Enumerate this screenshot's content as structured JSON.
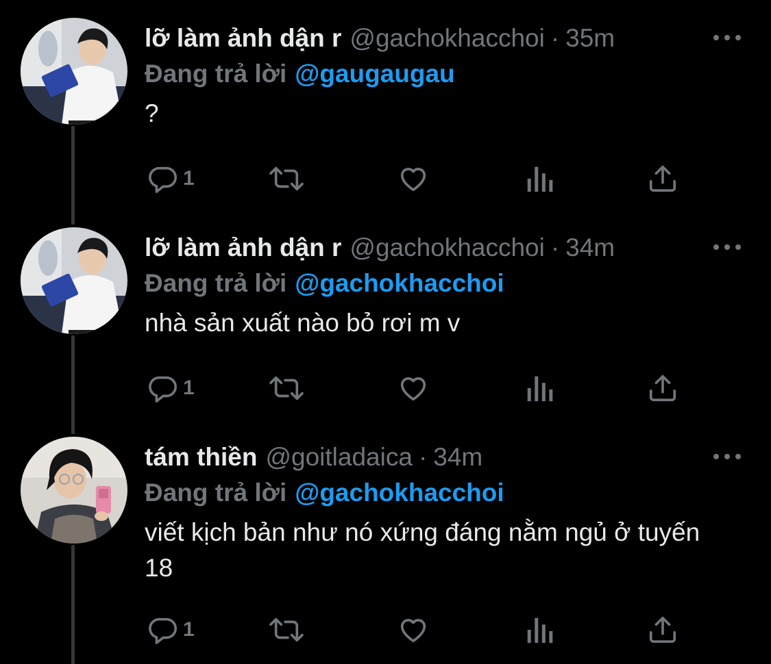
{
  "tweets": [
    {
      "display_name": "lỡ làm ảnh dận r",
      "handle": "@gachokhacchoi",
      "separator": "·",
      "time": "35m",
      "reply_label": "Đang trả lời",
      "reply_to": "@gaugaugau",
      "text": "?",
      "reply_count": "1",
      "avatar": "avatar-reading-airplane"
    },
    {
      "display_name": "lỡ làm ảnh dận r",
      "handle": "@gachokhacchoi",
      "separator": "·",
      "time": "34m",
      "reply_label": "Đang trả lời",
      "reply_to": "@gachokhacchoi",
      "text": "nhà sản xuất nào bỏ rơi m v",
      "reply_count": "1",
      "avatar": "avatar-reading-airplane"
    },
    {
      "display_name": "tám thiền",
      "handle": "@goitladaica",
      "separator": "·",
      "time": "34m",
      "reply_label": "Đang trả lời",
      "reply_to": "@gachokhacchoi",
      "text": "viết kịch bản như nó xứng đáng nằm ngủ ở tuyến 18",
      "reply_count": "1",
      "avatar": "avatar-mirror-selfie"
    }
  ],
  "icons": {
    "reply": "reply-icon",
    "retweet": "retweet-icon",
    "like": "like-icon",
    "views": "views-icon",
    "share": "share-icon",
    "more": "more-options-icon"
  },
  "colors": {
    "background": "#000000",
    "text_primary": "#e7e9ea",
    "text_secondary": "#71767b",
    "accent": "#1d9bf0",
    "thread_line": "#333639"
  }
}
